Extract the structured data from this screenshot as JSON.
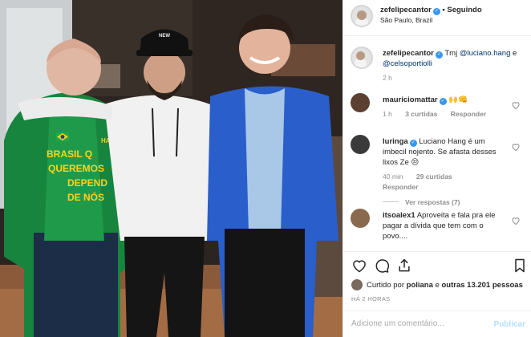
{
  "post": {
    "username": "zefelipecantor",
    "follow_status": "• Seguindo",
    "location": "São Paulo, Brazil"
  },
  "photo": {
    "shirt_text": [
      "BRASIL Q",
      "QUEREMOS",
      "DEPEND",
      "DE NÓS"
    ],
    "badge_text": "HAVAN",
    "cap_text": "NEW"
  },
  "caption": {
    "username": "zefelipecantor",
    "prefix": "Tmj",
    "mention1": "@luciano.hang",
    "connector": "e",
    "mention2": "@celsoportiolli",
    "age": "2 h"
  },
  "comments": [
    {
      "username": "mauriciomattar",
      "text": "🙌👊",
      "age": "1 h",
      "likes": "3 curtidas",
      "reply": "Responder",
      "avatar_color": "#5c4032"
    },
    {
      "username": "luringa",
      "text": "Luciano Hang é um imbecil nojento. Se afasta desses lixos Ze 😒",
      "age": "40 min",
      "likes": "29 curtidas",
      "reply": "Responder",
      "view_replies": "Ver respostas (7)",
      "avatar_color": "#3a3a3a"
    },
    {
      "username": "itsoalex1",
      "text": "Aproveita e fala pra ele pagar a dívida que tem com o povo....",
      "avatar_color": "#8a6a4e"
    }
  ],
  "liked_by": {
    "prefix": "Curtido por",
    "user": "poliana",
    "connector": "e",
    "others": "outras 13.201 pessoas"
  },
  "timestamp": "HÁ 2 HORAS",
  "comment_box": {
    "placeholder": "Adicione um comentário...",
    "post_label": "Publicar"
  },
  "colors": {
    "verified": "#3897f0",
    "secondary_text": "#8e8e8e",
    "publish_disabled": "#b2dffc",
    "border": "#efefef"
  }
}
